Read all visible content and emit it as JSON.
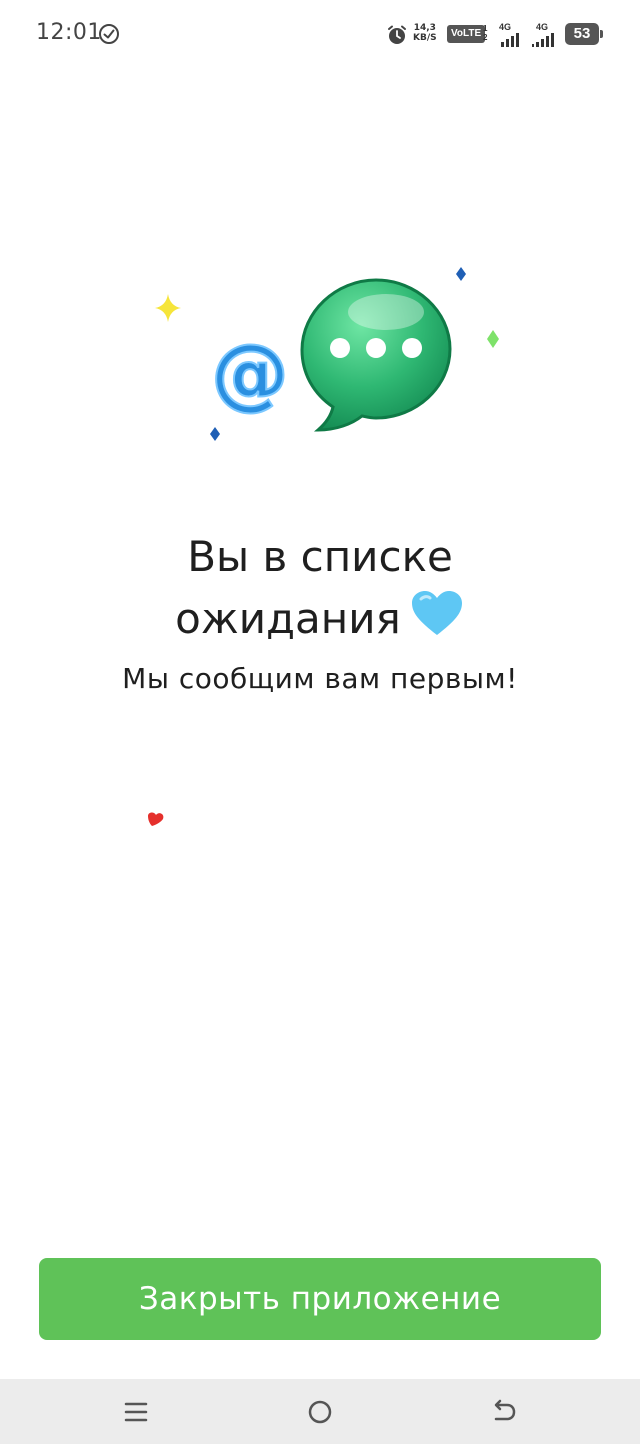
{
  "status_bar": {
    "time": "12:01",
    "net_speed_value": "14,3",
    "net_speed_unit": "KB/S",
    "volte": "VoLTE",
    "sim_1": "1",
    "sim_2": "2",
    "network_1": "4G",
    "network_2": "4G",
    "battery": "53",
    "icons": [
      "check-circle-icon",
      "alarm-icon",
      "signal-icon",
      "signal-icon",
      "battery-icon"
    ]
  },
  "waitlist": {
    "title_line1": "Вы в списке",
    "title_line2": "ожидания",
    "title_emoji": "light-blue-heart-icon",
    "subtitle": "Мы сообщим вам первым!"
  },
  "actions": {
    "close_label": "Закрыть приложение"
  },
  "nav_bar": {
    "icons": [
      "menu-icon",
      "home-icon",
      "back-icon"
    ]
  },
  "colors": {
    "button": "#5fc258",
    "bubble": "#2fb873",
    "at_sign": "#2a8fe0",
    "heart": "#5ec7f4"
  }
}
